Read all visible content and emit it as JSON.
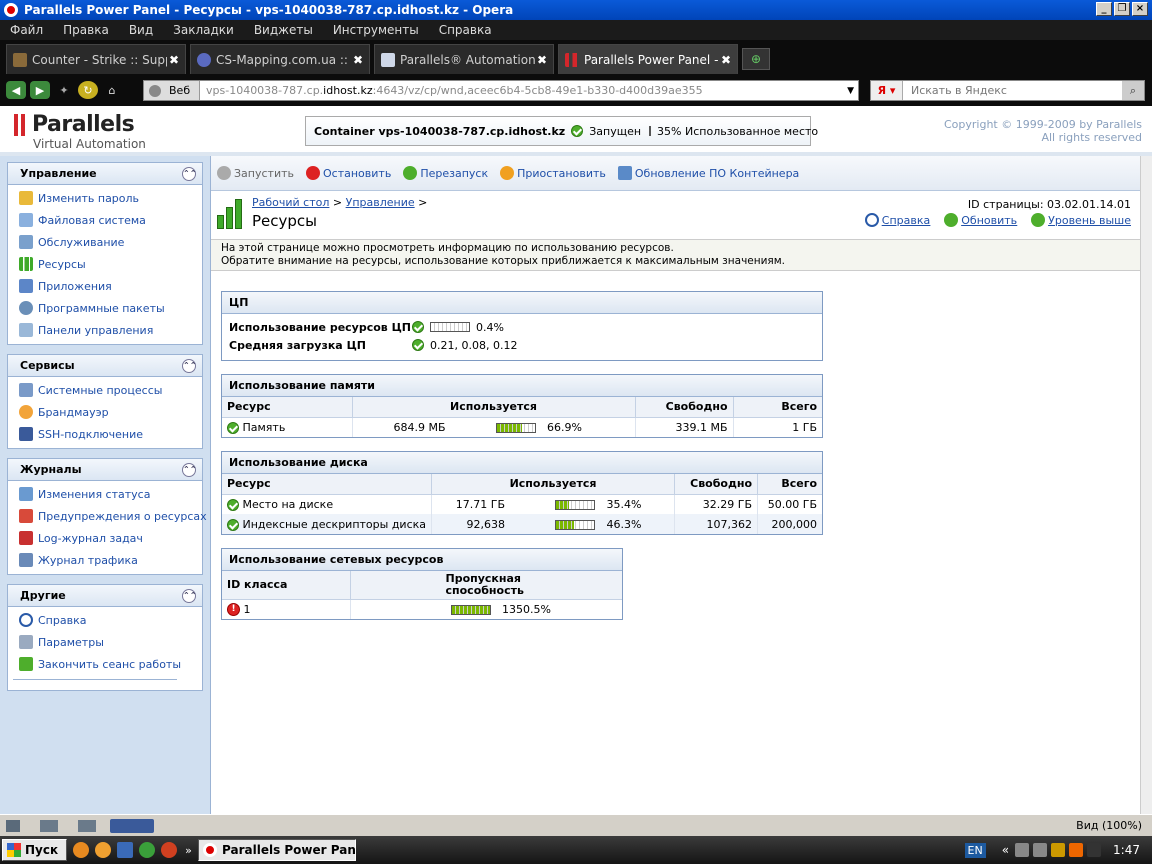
{
  "window": {
    "title": "Parallels Power Panel - Ресурсы - vps-1040038-787.cp.idhost.kz - Opera"
  },
  "menu": [
    "Файл",
    "Правка",
    "Вид",
    "Закладки",
    "Виджеты",
    "Инструменты",
    "Справка"
  ],
  "tabs": [
    {
      "label": "Counter - Strike :: Support..."
    },
    {
      "label": "CS-Mapping.com.ua :: Co..."
    },
    {
      "label": "Parallels® Automation"
    },
    {
      "label": "Parallels Power Panel - P..."
    }
  ],
  "address": {
    "web_label": "Веб",
    "url_prefix": "vps-1040038-787.cp.",
    "url_host": "idhost.kz",
    "url_rest": ":4643/vz/cp/wnd,aceec6b4-5cb8-49e1-b330-d400d39ae355"
  },
  "search": {
    "placeholder": "Искать в Яндекс"
  },
  "brand": {
    "name": "Parallels",
    "sub": "Virtual Automation"
  },
  "container": {
    "label": "Container vps-1040038-787.cp.idhost.kz",
    "state": "Запущен",
    "usage_percent": 35,
    "usage_text": "35% Использованное место"
  },
  "copyright": {
    "line1": "Copyright © 1999-2009 by Parallels",
    "line2": "All rights reserved"
  },
  "sidebar": {
    "sections": [
      {
        "title": "Управление",
        "items": [
          "Изменить пароль",
          "Файловая система",
          "Обслуживание",
          "Ресурсы",
          "Приложения",
          "Программные пакеты",
          "Панели управления"
        ]
      },
      {
        "title": "Сервисы",
        "items": [
          "Системные процессы",
          "Брандмауэр",
          "SSH-подключение"
        ]
      },
      {
        "title": "Журналы",
        "items": [
          "Изменения статуса",
          "Предупреждения о ресурсах",
          "Log-журнал задач",
          "Журнал трафика"
        ]
      },
      {
        "title": "Другие",
        "items": [
          "Справка",
          "Параметры",
          "Закончить сеанс работы"
        ]
      }
    ]
  },
  "toolbar": {
    "start": "Запустить",
    "stop": "Остановить",
    "restart": "Перезапуск",
    "suspend": "Приостановить",
    "update": "Обновление ПО Контейнера"
  },
  "page": {
    "crumb1": "Рабочий стол",
    "crumb2": "Управление",
    "sep": ">",
    "title": "Ресурсы",
    "page_id": "ID страницы: 03.02.01.14.01",
    "help": "Справка",
    "refresh": "Обновить",
    "up": "Уровень выше",
    "desc1": "На этой странице можно просмотреть информацию по использованию ресурсов.",
    "desc2": "Обратите внимание на ресурсы, использование которых приближается к максимальным значениям."
  },
  "cpu": {
    "title": "ЦП",
    "usage_label": "Использование ресурсов ЦП",
    "usage_percent": 0.4,
    "usage_text": "0.4%",
    "load_label": "Средняя загрузка ЦП",
    "load_value": "0.21, 0.08, 0.12"
  },
  "memory": {
    "title": "Использование памяти",
    "headers": {
      "resource": "Ресурс",
      "used": "Используется",
      "free": "Свободно",
      "total": "Всего"
    },
    "rows": [
      {
        "name": "Память",
        "used": "684.9 МБ",
        "percent": 66.9,
        "percent_text": "66.9%",
        "free": "339.1 МБ",
        "total": "1 ГБ"
      }
    ]
  },
  "disk": {
    "title": "Использование диска",
    "headers": {
      "resource": "Ресурс",
      "used": "Используется",
      "free": "Свободно",
      "total": "Всего"
    },
    "rows": [
      {
        "name": "Место на диске",
        "used": "17.71 ГБ",
        "percent": 35.4,
        "percent_text": "35.4%",
        "free": "32.29 ГБ",
        "total": "50.00 ГБ"
      },
      {
        "name": "Индексные дескрипторы диска",
        "used": "92,638",
        "percent": 46.3,
        "percent_text": "46.3%",
        "free": "107,362",
        "total": "200,000"
      }
    ]
  },
  "network": {
    "title": "Использование сетевых ресурсов",
    "headers": {
      "class_id": "ID класса",
      "bandwidth_1": "Пропускная",
      "bandwidth_2": "способность"
    },
    "rows": [
      {
        "id": "1",
        "percent": 100,
        "percent_text": "1350.5%"
      }
    ]
  },
  "statusbar": {
    "zoom": "Вид (100%)"
  },
  "taskbar": {
    "start": "Пуск",
    "app": "Parallels Power Pane...",
    "lang": "EN",
    "clock": "1:47"
  },
  "colors": {
    "bar_fill": "#7ab800",
    "link": "#1f4fa8",
    "ok": "#4eae2c",
    "error": "#d22222"
  }
}
